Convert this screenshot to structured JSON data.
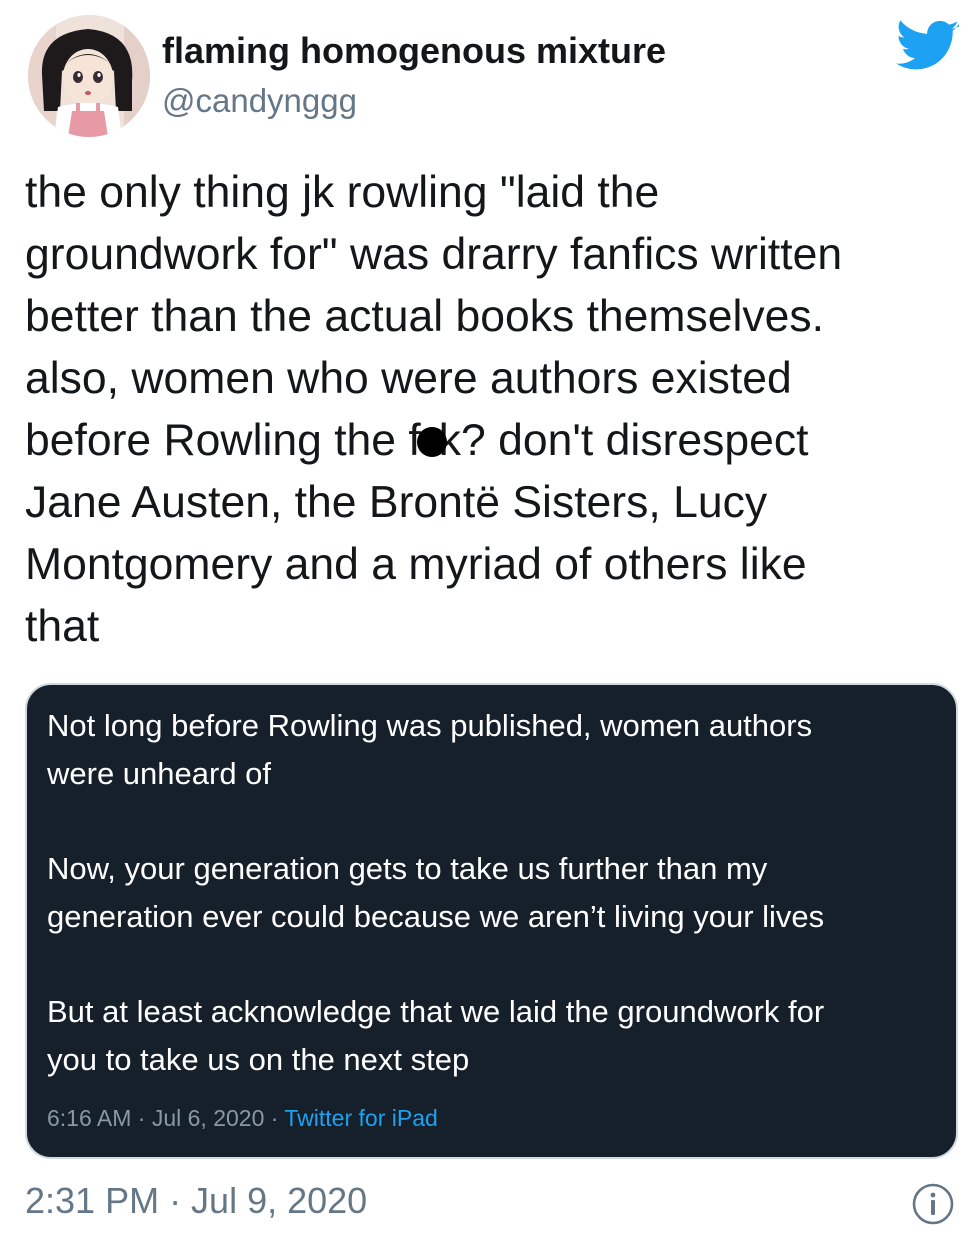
{
  "author": {
    "display_name": "flaming homogenous mixture",
    "handle": "@candynggg"
  },
  "icons": {
    "brand": "twitter-bird-icon",
    "info": "info-icon",
    "brand_color": "#1da1f2"
  },
  "tweet": {
    "lines": [
      "the only thing jk rowling \"laid the",
      "groundwork for\" was drarry fanfics written",
      "better than the actual books themselves.",
      "also, women who were authors existed",
      "don't disrespect",
      "Jane Austen, the Brontë Sisters, Lucy",
      "Montgomery and a myriad of others like",
      "that"
    ],
    "censored_line": {
      "before": "before Rowling the f",
      "after": "k?"
    },
    "timestamp": "2:31 PM · Jul 9, 2020"
  },
  "embedded_screenshot": {
    "background": "#15202b",
    "paragraphs": [
      [
        "Not long before Rowling was published, women authors",
        "were unheard of"
      ],
      [
        "Now, your generation gets to take us further than my",
        "generation ever could because we aren’t living your lives"
      ],
      [
        "But at least acknowledge that we laid the groundwork for",
        "you to take us on the next step"
      ]
    ],
    "meta": {
      "time": "6:16 AM · Jul 6, 2020 · ",
      "source": "Twitter for iPad"
    }
  }
}
